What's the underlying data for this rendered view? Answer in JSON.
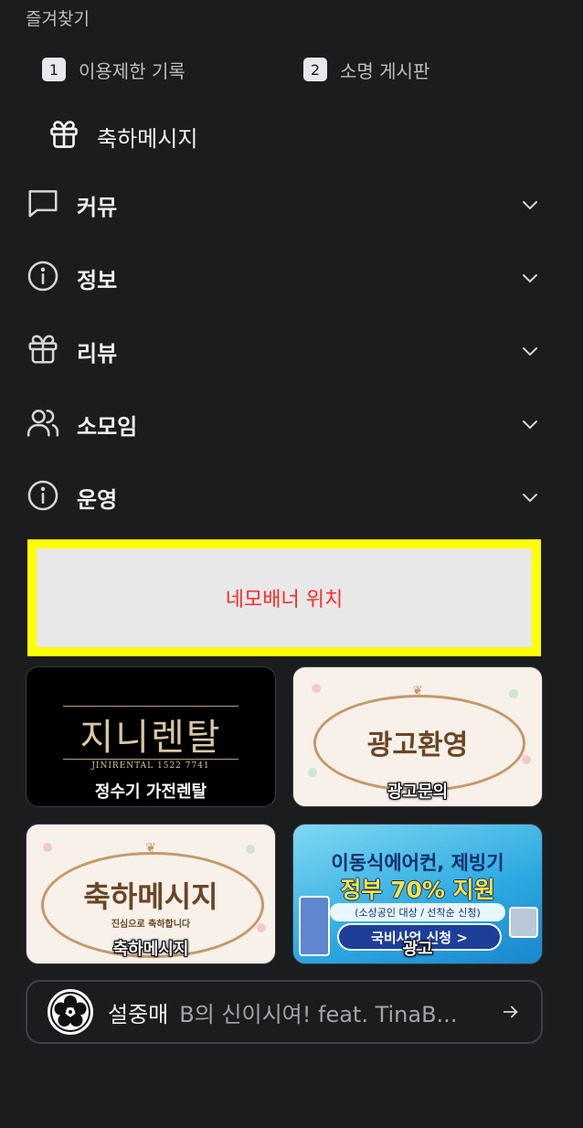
{
  "favorites": {
    "title": "즐겨찾기",
    "items": [
      {
        "num": "1",
        "label": "이용제한 기록"
      },
      {
        "num": "2",
        "label": "소명 게시판"
      }
    ],
    "gift_label": "축하메시지"
  },
  "menu": [
    {
      "label": "커뮤",
      "icon": "chat-icon"
    },
    {
      "label": "정보",
      "icon": "info-icon"
    },
    {
      "label": "리뷰",
      "icon": "gift-icon"
    },
    {
      "label": "소모임",
      "icon": "users-icon"
    },
    {
      "label": "운영",
      "icon": "info-icon"
    }
  ],
  "banner": {
    "text": "네모배너 위치",
    "border_color": "#ffff00",
    "text_color": "#ff2a2a"
  },
  "cards": [
    {
      "caption": "정수기 가전렌탈",
      "art_title": "지니렌탈",
      "art_sub": "JINIRENTAL 1522 7741"
    },
    {
      "caption": "광고문의",
      "art_title": "광고환영"
    },
    {
      "caption": "축하메시지",
      "art_title": "축하메시지",
      "art_sub": "진심으로 축하합니다"
    },
    {
      "caption": "광고",
      "art_line1": "이동식에어컨, 제빙기",
      "art_line2": "정부 70% 지원",
      "art_line3": "(소상공인 대상 / 선착순 신청)",
      "art_button": "국비사업 신청 >"
    }
  ],
  "now_playing": {
    "title": "설중매",
    "subtitle": "B의 신이시여! feat. TinaB..."
  }
}
